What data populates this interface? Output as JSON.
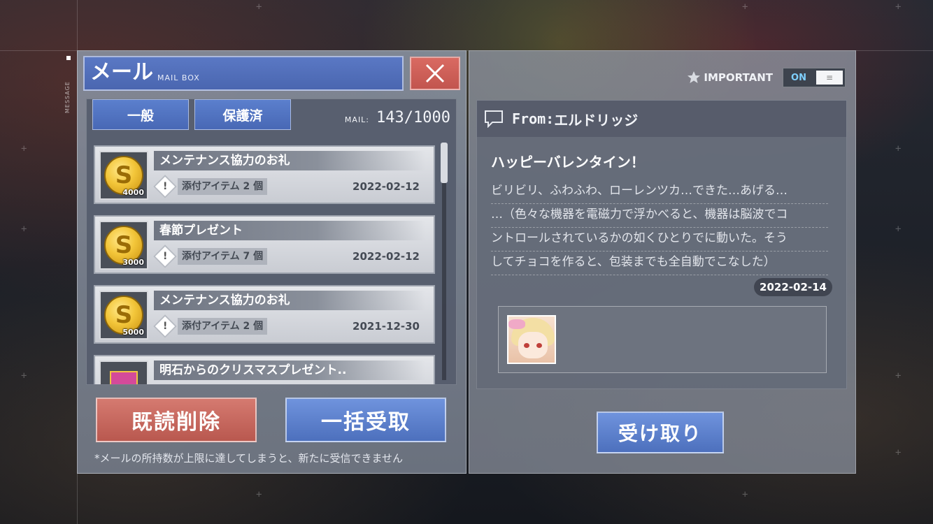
{
  "side_tag": "MESSAGE",
  "mailbox": {
    "title": "メール",
    "subtitle": "MAIL BOX",
    "tabs": [
      "一般",
      "保護済"
    ],
    "count_label": "MAIL:",
    "count_value": "143/1000",
    "items": [
      {
        "subject": "メンテナンス協力のお礼",
        "attach_label": "添付アイテム",
        "attach_count": "2 個",
        "date": "2022-02-12",
        "icon": "gold-coin-icon",
        "amount": "4000"
      },
      {
        "subject": "春節プレゼント",
        "attach_label": "添付アイテム",
        "attach_count": "7 個",
        "date": "2022-02-12",
        "icon": "gold-coin-icon",
        "amount": "3000"
      },
      {
        "subject": "メンテナンス協力のお礼",
        "attach_label": "添付アイテム",
        "attach_count": "2 個",
        "date": "2021-12-30",
        "icon": "gold-coin-icon",
        "amount": "5000"
      },
      {
        "subject": "明石からのクリスマスプレゼント..",
        "icon": "gift-box-icon"
      }
    ],
    "delete_read_label": "既読削除",
    "claim_all_label": "一括受取",
    "notice": "*メールの所持数が上限に達してしまうと、新たに受信できません"
  },
  "detail": {
    "important_label": "IMPORTANT",
    "toggle_label": "ON",
    "from_label": "From:",
    "from_name": "エルドリッジ",
    "title": "ハッピーバレンタイン！",
    "body_lines": [
      "ビリビリ、ふわふわ、ローレンツカ…できた…あげる…",
      "…（色々な機器を電磁力で浮かべると、機器は脳波でコ",
      "ントロールされているかの如くひとりでに動いた。そう",
      "してチョコを作ると、包装までも全自動でこなした）"
    ],
    "date": "2022-02-14",
    "attachment_icon": "character-portrait-icon",
    "receive_label": "受け取り"
  },
  "colors": {
    "primary_blue": "#4d70bd",
    "danger_red": "#b9584f"
  }
}
